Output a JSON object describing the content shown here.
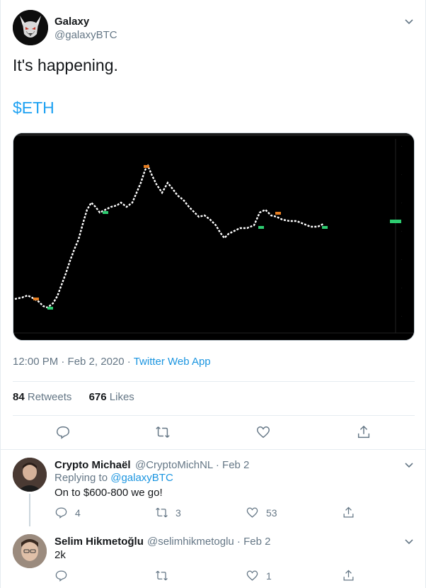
{
  "tweet": {
    "author_name": "Galaxy",
    "author_handle": "@galaxyBTC",
    "text": "It's happening.",
    "cashtag": "$ETH",
    "timestamp": "12:00 PM · Feb 2, 2020",
    "via": "Twitter Web App",
    "retweets_count": "84",
    "retweets_label": "Retweets",
    "likes_count": "676",
    "likes_label": "Likes"
  },
  "replies": [
    {
      "name": "Crypto Michaël",
      "handle": "@CryptoMichNL · Feb 2",
      "replying_label": "Replying to",
      "replying_to": "@galaxyBTC",
      "text": "On to $600-800 we go!",
      "reply_count": "4",
      "retweet_count": "3",
      "like_count": "53"
    },
    {
      "name": "Selim Hikmetoğlu",
      "handle": "@selimhikmetoglu · Feb 2",
      "text": "2k",
      "reply_count": "",
      "retweet_count": "",
      "like_count": "1"
    }
  ],
  "icons": {
    "accent": "#1da1f2",
    "muted": "#657786"
  }
}
